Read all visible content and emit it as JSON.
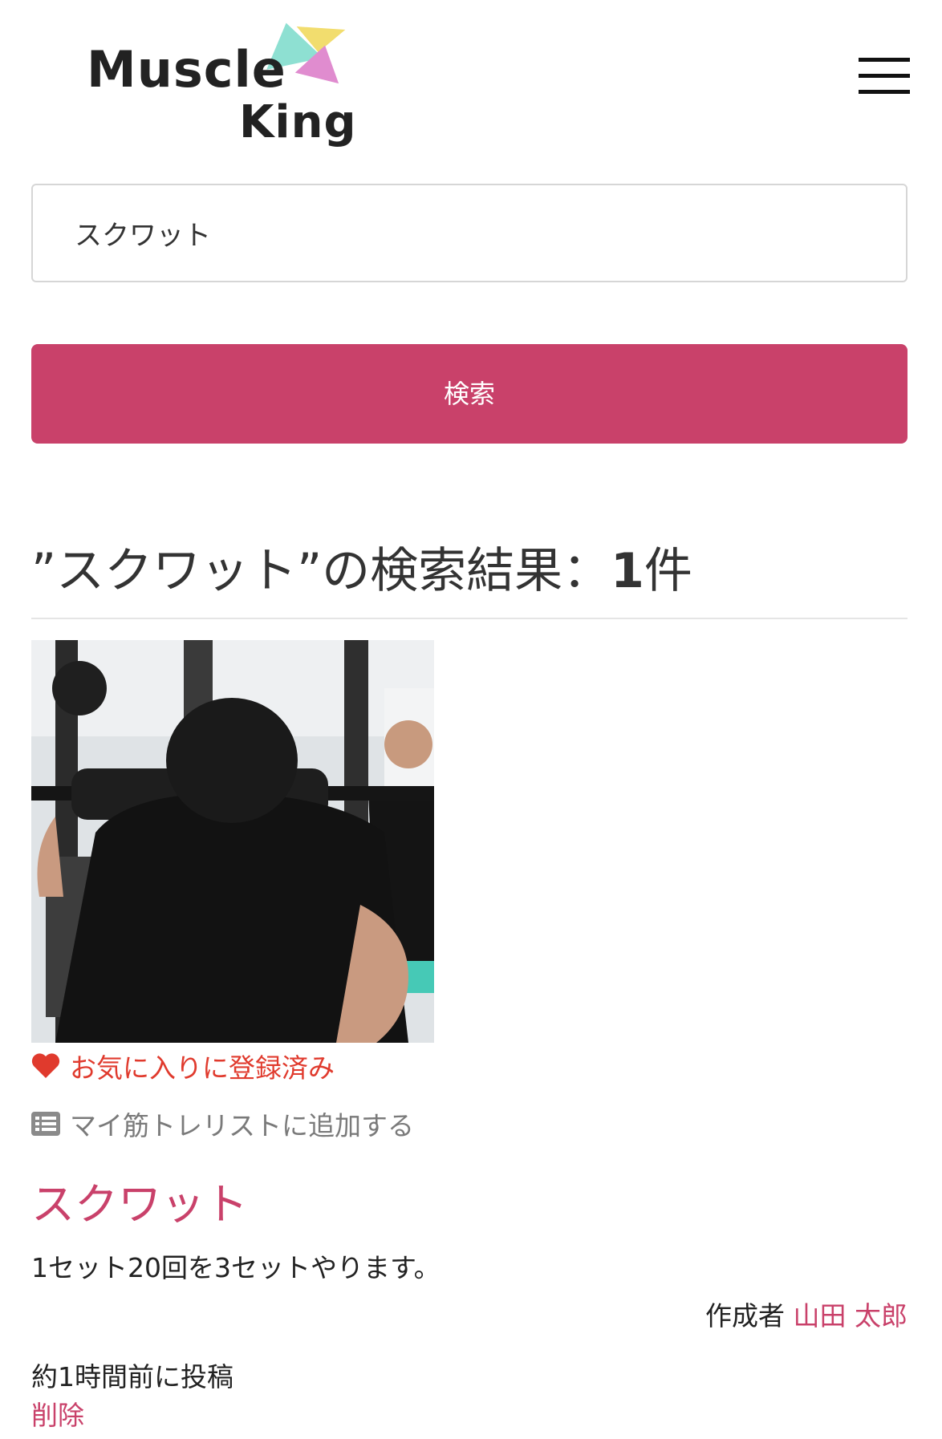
{
  "header": {
    "logo_line1": "Muscle",
    "logo_line2": "King",
    "menu_icon": "hamburger-menu-icon"
  },
  "search": {
    "value": "スクワット",
    "button_label": "検索"
  },
  "results": {
    "heading_prefix": "”スクワット”の検索結果：",
    "count": "1",
    "count_suffix": "件"
  },
  "post": {
    "image_alt": "スクワット",
    "favorite_label": "お気に入りに登録済み",
    "favorite_icon": "heart-icon",
    "mylist_label": "マイ筋トレリストに追加する",
    "mylist_icon": "list-icon",
    "title": "スクワット",
    "description": "1セット20回を3セットやります。",
    "author_label": "作成者",
    "author_name": "山田 太郎",
    "posted_at": "約1時間前に投稿",
    "delete_label": "削除"
  },
  "colors": {
    "brand_pink": "#c9416a",
    "favorite_red": "#e03a2d",
    "logo_teal": "#8ee0d2",
    "logo_yellow": "#f2dd6e",
    "logo_pink": "#e08ccf"
  }
}
